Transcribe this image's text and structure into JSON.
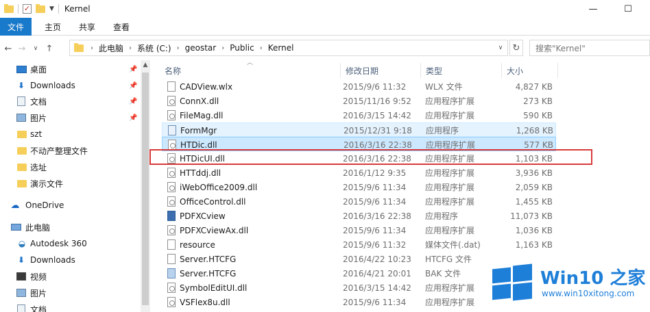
{
  "window": {
    "title": "Kernel",
    "minimize": "—",
    "maximize": "☐"
  },
  "ribbon": {
    "tabs": [
      "文件",
      "主页",
      "共享",
      "查看"
    ]
  },
  "address": {
    "crumbs": [
      "此电脑",
      "系统 (C:)",
      "geostar",
      "Public",
      "Kernel"
    ],
    "search_placeholder": "搜索\"Kernel\""
  },
  "navpane": {
    "items": [
      {
        "label": "桌面",
        "icon": "desktop-icon",
        "pinned": true
      },
      {
        "label": "Downloads",
        "icon": "download-icon",
        "pinned": true
      },
      {
        "label": "文档",
        "icon": "document-icon",
        "pinned": true
      },
      {
        "label": "图片",
        "icon": "picture-icon",
        "pinned": true
      },
      {
        "label": "szt",
        "icon": "folder-icon",
        "pinned": false
      },
      {
        "label": "不动产整理文件",
        "icon": "folder-icon",
        "pinned": false
      },
      {
        "label": "选址",
        "icon": "folder-icon",
        "pinned": false
      },
      {
        "label": "演示文件",
        "icon": "folder-icon",
        "pinned": false
      },
      {
        "label": "OneDrive",
        "icon": "onedrive-cloud-icon",
        "pinned": false
      },
      {
        "label": "此电脑",
        "icon": "this-pc-icon",
        "pinned": false
      },
      {
        "label": "Autodesk 360",
        "icon": "autodesk-icon",
        "pinned": false
      },
      {
        "label": "Downloads",
        "icon": "download-icon",
        "pinned": false
      },
      {
        "label": "视频",
        "icon": "video-icon",
        "pinned": false
      },
      {
        "label": "图片",
        "icon": "picture-icon",
        "pinned": false
      },
      {
        "label": "文档",
        "icon": "document-icon",
        "pinned": false
      }
    ]
  },
  "columns": {
    "name": "名称",
    "date": "修改日期",
    "type": "类型",
    "size": "大小"
  },
  "files": [
    {
      "name": "CADView.wlx",
      "date": "2015/9/6 11:32",
      "type": "WLX 文件",
      "size": "4,827 KB",
      "icon": "file-icon"
    },
    {
      "name": "ConnX.dll",
      "date": "2015/11/16 9:52",
      "type": "应用程序扩展",
      "size": "273 KB",
      "icon": "dll-file-icon"
    },
    {
      "name": "FileMag.dll",
      "date": "2016/3/15 14:42",
      "type": "应用程序扩展",
      "size": "590 KB",
      "icon": "dll-file-icon"
    },
    {
      "name": "FormMgr",
      "date": "2015/12/31 9:18",
      "type": "应用程序",
      "size": "1,268 KB",
      "icon": "application-icon"
    },
    {
      "name": "HTDic.dll",
      "date": "2016/3/16 22:38",
      "type": "应用程序扩展",
      "size": "577 KB",
      "icon": "dll-file-icon"
    },
    {
      "name": "HTDicUI.dll",
      "date": "2016/3/16 22:38",
      "type": "应用程序扩展",
      "size": "1,103 KB",
      "icon": "dll-file-icon"
    },
    {
      "name": "HTTddj.dll",
      "date": "2016/1/12 9:35",
      "type": "应用程序扩展",
      "size": "3,936 KB",
      "icon": "dll-file-icon"
    },
    {
      "name": "iWebOffice2009.dll",
      "date": "2015/9/6 11:34",
      "type": "应用程序扩展",
      "size": "2,059 KB",
      "icon": "dll-file-icon"
    },
    {
      "name": "OfficeControl.dll",
      "date": "2015/9/6 11:34",
      "type": "应用程序扩展",
      "size": "1,455 KB",
      "icon": "dll-file-icon"
    },
    {
      "name": "PDFXCview",
      "date": "2016/3/16 22:38",
      "type": "应用程序",
      "size": "11,073 KB",
      "icon": "pdf-application-icon"
    },
    {
      "name": "PDFXCviewAx.dll",
      "date": "2015/9/6 11:34",
      "type": "应用程序扩展",
      "size": "1,036 KB",
      "icon": "dll-file-icon"
    },
    {
      "name": "resource",
      "date": "2015/9/6 11:32",
      "type": "媒体文件(.dat)",
      "size": "1,163 KB",
      "icon": "file-icon"
    },
    {
      "name": "Server.HTCFG",
      "date": "2016/4/22 10:23",
      "type": "HTCFG 文件",
      "size": "",
      "icon": "file-icon"
    },
    {
      "name": "Server.HTCFG",
      "date": "2016/4/21 20:01",
      "type": "BAK 文件",
      "size": "",
      "icon": "bak-file-icon"
    },
    {
      "name": "SymbolEditUI.dll",
      "date": "2016/3/15 14:42",
      "type": "应用程序扩展",
      "size": "",
      "icon": "dll-file-icon"
    },
    {
      "name": "VSFlex8u.dll",
      "date": "2015/9/6 11:34",
      "type": "应用程序扩展",
      "size": "",
      "icon": "dll-file-icon"
    }
  ],
  "watermark": {
    "title": "Win10 之家",
    "url": "www.win10xitong.com",
    "color": "#1e7fd8"
  },
  "colors": {
    "accent": "#1979ca",
    "selection": "#cce8ff",
    "highlight_box": "#d93a3a"
  }
}
